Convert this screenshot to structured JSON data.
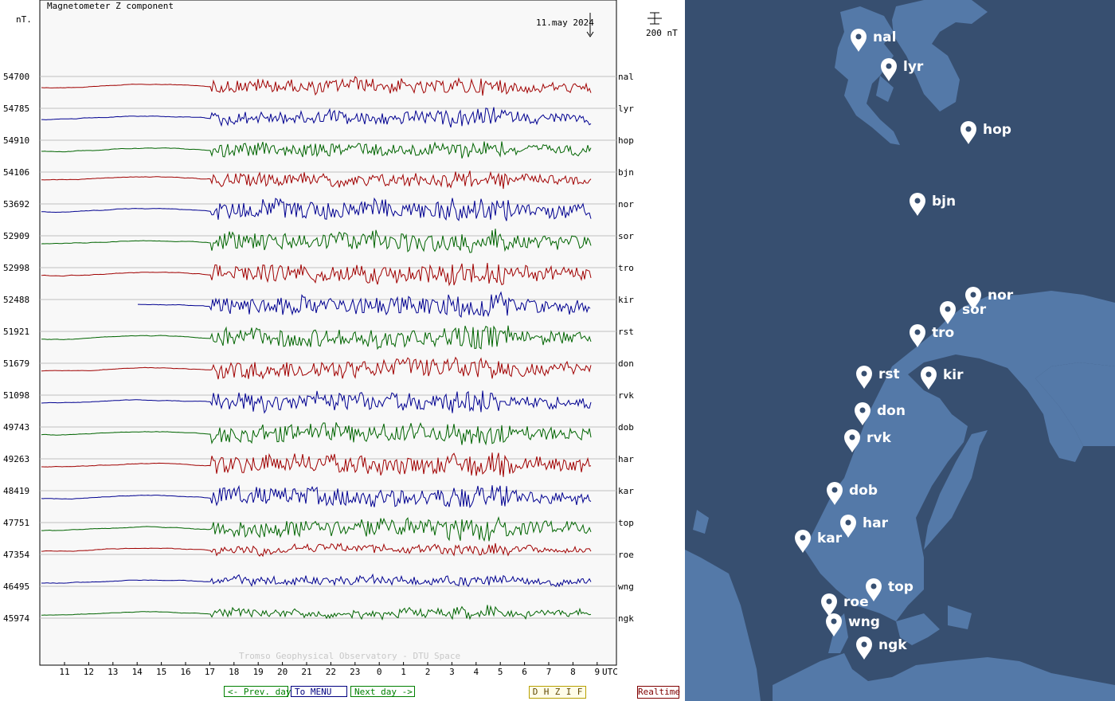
{
  "title": "Magnetometer Z component",
  "unit_label": "nT.",
  "date_label": "11.may 2024",
  "scale_label": "200 nT",
  "watermark": "Tromso Geophysical Observatory - DTU Space",
  "nav": {
    "prev": "<- Prev. day",
    "menu": "To MENU",
    "next": "Next day ->",
    "components": [
      "D",
      "H",
      "Z",
      "I",
      "F"
    ],
    "realtime": "Realtime"
  },
  "colors": {
    "red": "#a00000",
    "blue": "#000090",
    "green": "#006400",
    "map_land": "#5479a8",
    "map_sea": "#374f70"
  },
  "chart_data": {
    "type": "line",
    "title": "Magnetometer Z component",
    "xlabel": "UTC",
    "x_ticks": [
      "11",
      "12",
      "13",
      "14",
      "15",
      "16",
      "17",
      "18",
      "19",
      "20",
      "21",
      "22",
      "23",
      "0",
      "1",
      "2",
      "3",
      "4",
      "5",
      "6",
      "7",
      "8",
      "9"
    ],
    "scale_bar_nT": 200,
    "series": [
      {
        "station": "nal",
        "baseline": "54700",
        "color": "red"
      },
      {
        "station": "lyr",
        "baseline": "54785",
        "color": "blue"
      },
      {
        "station": "hop",
        "baseline": "54910",
        "color": "green"
      },
      {
        "station": "bjn",
        "baseline": "54106",
        "color": "red"
      },
      {
        "station": "nor",
        "baseline": "53692",
        "color": "blue"
      },
      {
        "station": "sor",
        "baseline": "52909",
        "color": "green"
      },
      {
        "station": "tro",
        "baseline": "52998",
        "color": "red"
      },
      {
        "station": "kir",
        "baseline": "52488",
        "color": "blue"
      },
      {
        "station": "rst",
        "baseline": "51921",
        "color": "green"
      },
      {
        "station": "don",
        "baseline": "51679",
        "color": "red"
      },
      {
        "station": "rvk",
        "baseline": "51098",
        "color": "blue"
      },
      {
        "station": "dob",
        "baseline": "49743",
        "color": "green"
      },
      {
        "station": "har",
        "baseline": "49263",
        "color": "red"
      },
      {
        "station": "kar",
        "baseline": "48419",
        "color": "blue"
      },
      {
        "station": "top",
        "baseline": "47751",
        "color": "green"
      },
      {
        "station": "roe",
        "baseline": "47354",
        "color": "red"
      },
      {
        "station": "wng",
        "baseline": "46495",
        "color": "blue"
      },
      {
        "station": "ngk",
        "baseline": "45974",
        "color": "green"
      }
    ]
  },
  "map": {
    "markers": [
      {
        "label": "nal"
      },
      {
        "label": "lyr"
      },
      {
        "label": "hop"
      },
      {
        "label": "bjn"
      },
      {
        "label": "nor"
      },
      {
        "label": "sor"
      },
      {
        "label": "tro"
      },
      {
        "label": "rst"
      },
      {
        "label": "kir"
      },
      {
        "label": "don"
      },
      {
        "label": "rvk"
      },
      {
        "label": "dob"
      },
      {
        "label": "har"
      },
      {
        "label": "kar"
      },
      {
        "label": "top"
      },
      {
        "label": "roe"
      },
      {
        "label": "wng"
      },
      {
        "label": "ngk"
      }
    ]
  }
}
